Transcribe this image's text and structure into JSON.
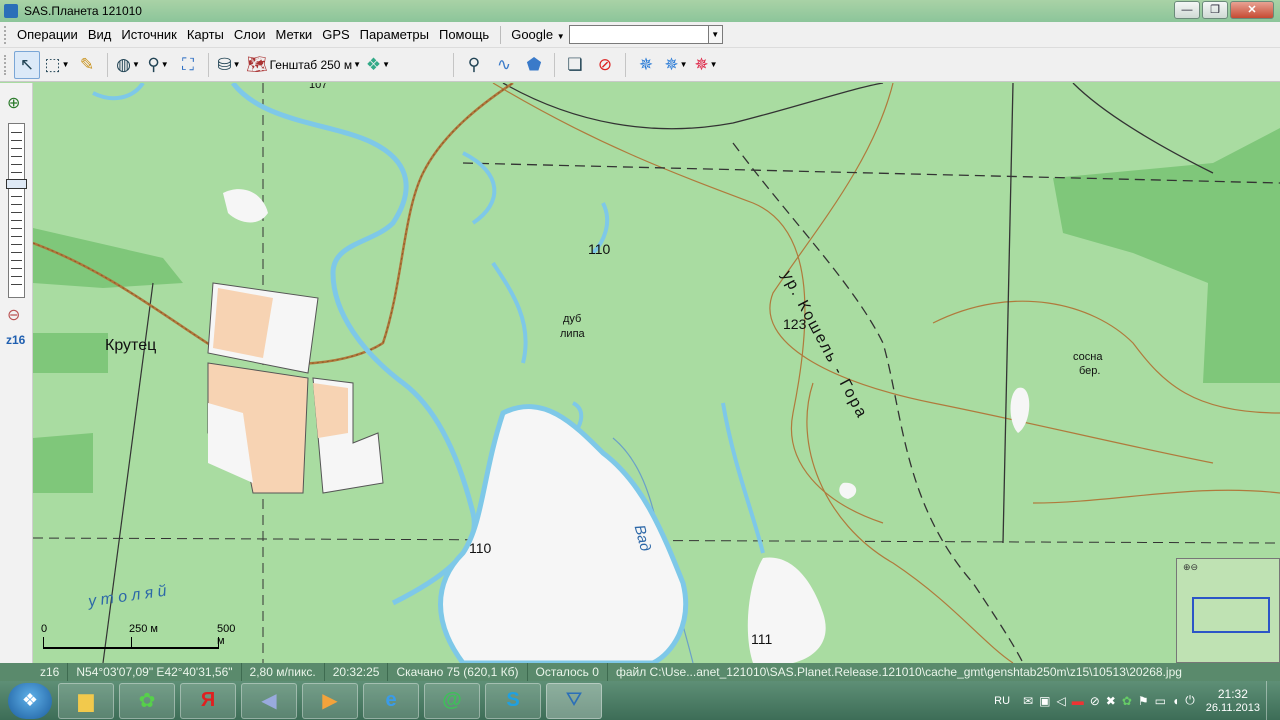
{
  "window": {
    "title": "SAS.Планета 121010",
    "buttons": {
      "minimize": "—",
      "maximize": "❐",
      "close": "✕"
    }
  },
  "menu": {
    "items": [
      "Операции",
      "Вид",
      "Источник",
      "Карты",
      "Слои",
      "Метки",
      "GPS",
      "Параметры",
      "Помощь"
    ],
    "search_engine": "Google",
    "search_value": ""
  },
  "toolbar": {
    "layer_label": "Генштаб 250 м"
  },
  "zoombar": {
    "zoom_level": "z16"
  },
  "map": {
    "labels": {
      "krutets": "Крутец",
      "h110_top": "110",
      "dub": "дуб",
      "lipa": "липа",
      "h123": "123",
      "koshel": "ур. Кошель - Гора",
      "sosna": "сосна",
      "ber": "бер.",
      "h110_bottom": "110",
      "vad": "Вад",
      "utolyai": "у т о л я й",
      "h111": "111",
      "h107": "107"
    },
    "scale": {
      "start": "0",
      "mid": "250 м",
      "end": "500 м"
    }
  },
  "status": {
    "zoom": "z16",
    "coords": "N54°03'07,09\" E42°40'31,56\"",
    "resolution": "2,80 м/пикс.",
    "time": "20:32:25",
    "downloaded": "Скачано 75 (620,1 Кб)",
    "remaining": "Осталось 0",
    "file": "файл C:\\Use...anet_121010\\SAS.Planet.Release.121010\\cache_gmt\\genshtab250m\\z15\\10513\\20268.jpg"
  },
  "taskbar": {
    "tray_lang": "RU",
    "clock_time": "21:32",
    "clock_date": "26.11.2013"
  }
}
